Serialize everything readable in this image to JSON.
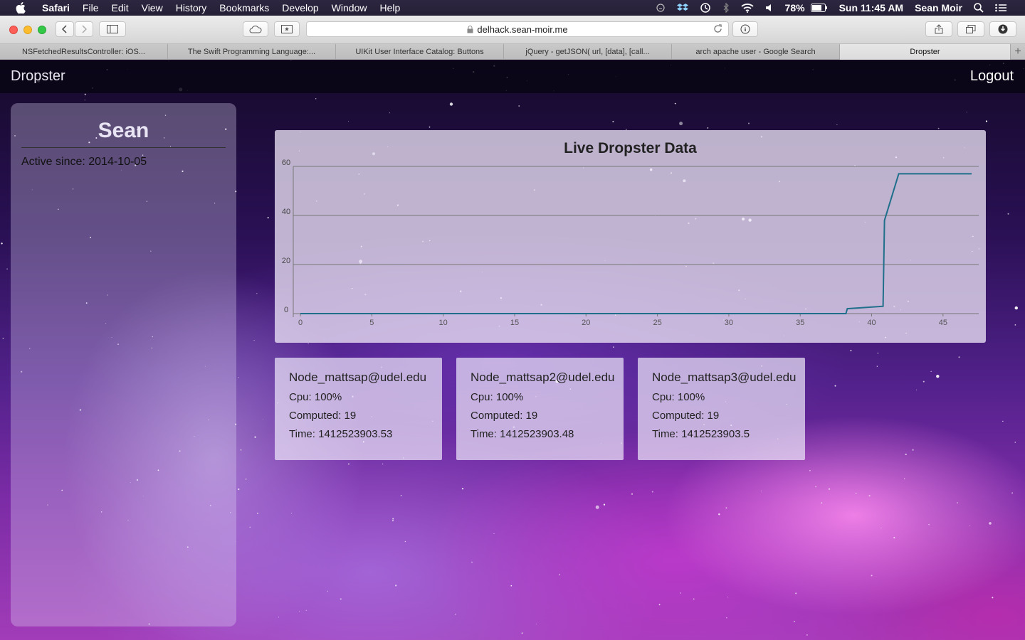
{
  "menubar": {
    "items": [
      "Safari",
      "File",
      "Edit",
      "View",
      "History",
      "Bookmarks",
      "Develop",
      "Window",
      "Help"
    ],
    "battery": "78%",
    "clock": "Sun 11:45 AM",
    "user": "Sean Moir"
  },
  "browser": {
    "url": "delhack.sean-moir.me",
    "tabs": [
      "NSFetchedResultsController: iOS...",
      "The Swift Programming Language:...",
      "UIKit User Interface Catalog: Buttons",
      "jQuery - getJSON( url, [data], [call...",
      "arch apache user - Google Search",
      "Dropster"
    ],
    "active_tab": 5
  },
  "app": {
    "brand": "Dropster",
    "logout": "Logout"
  },
  "profile": {
    "name": "Sean",
    "active_since": "Active since: 2014-10-05"
  },
  "chart_data": {
    "type": "line",
    "title": "Live Dropster Data",
    "xlabel": "",
    "ylabel": "",
    "xlim": [
      -0.5,
      47.5
    ],
    "ylim": [
      0,
      60
    ],
    "x_ticks": [
      0,
      5,
      10,
      15,
      20,
      25,
      30,
      35,
      40,
      45
    ],
    "y_ticks": [
      0,
      20,
      40,
      60
    ],
    "grid": "horizontal",
    "line_color": "#1f6f8b",
    "x": [
      0,
      38.2,
      38.3,
      40.8,
      40.9,
      41.9,
      47
    ],
    "y": [
      0,
      0,
      2,
      3,
      38,
      57,
      57
    ]
  },
  "nodes": [
    {
      "name": "Node_mattsap@udel.edu",
      "cpu": "Cpu: 100%",
      "computed": "Computed: 19",
      "time": "Time: 1412523903.53"
    },
    {
      "name": "Node_mattsap2@udel.edu",
      "cpu": "Cpu: 100%",
      "computed": "Computed: 19",
      "time": "Time: 1412523903.48"
    },
    {
      "name": "Node_mattsap3@udel.edu",
      "cpu": "Cpu: 100%",
      "computed": "Computed: 19",
      "time": "Time: 1412523903.5"
    }
  ]
}
